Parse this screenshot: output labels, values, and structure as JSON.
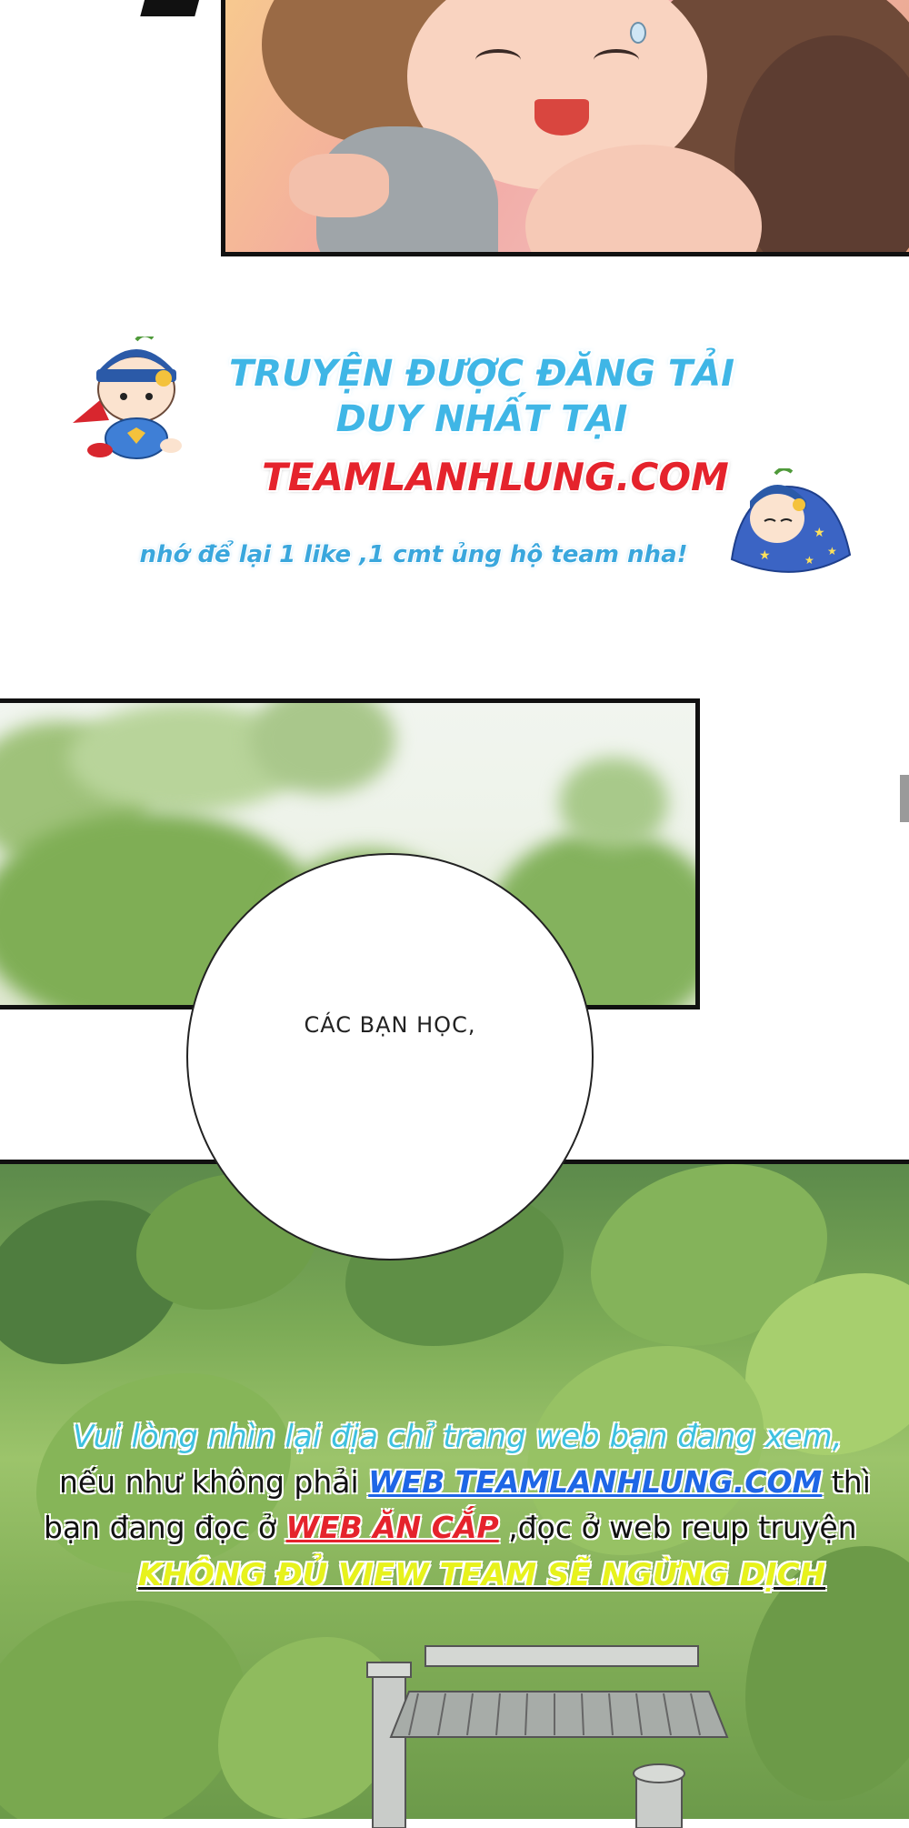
{
  "credit": {
    "line1": "TRUYỆN ĐƯỢC ĐĂNG TẢI",
    "line2": "DUY NHẤT TẠI",
    "site": "TEAMLANHLUNG.COM",
    "note": "nhớ để lại 1 like ,1 cmt ủng hộ team nha!"
  },
  "speech": {
    "text": "CÁC BẠN HỌC,"
  },
  "notice": {
    "line1": "Vui lòng nhìn lại địa chỉ trang web bạn đang xem,",
    "line2_prefix": "nếu như không phải ",
    "line2_link": "WEB TEAMLANHLUNG.COM",
    "line2_suffix": " thì",
    "line3_prefix": "bạn đang đọc ở ",
    "line3_link": "WEB ĂN CẮP",
    "line3_suffix": " ,đọc ở web reup truyện",
    "line4": "KHÔNG ĐỦ VIEW TEAM SẼ NGỪNG DỊCH"
  },
  "colors": {
    "credit_blue": "#3fb6e6",
    "credit_red": "#e5232c",
    "notice_cyan": "#3ec1e0",
    "notice_link_blue": "#1e66e6",
    "notice_yellow": "#e7f21c"
  },
  "icons": [
    "chibi-superhero-mascot",
    "chibi-sleeping-mascot"
  ]
}
